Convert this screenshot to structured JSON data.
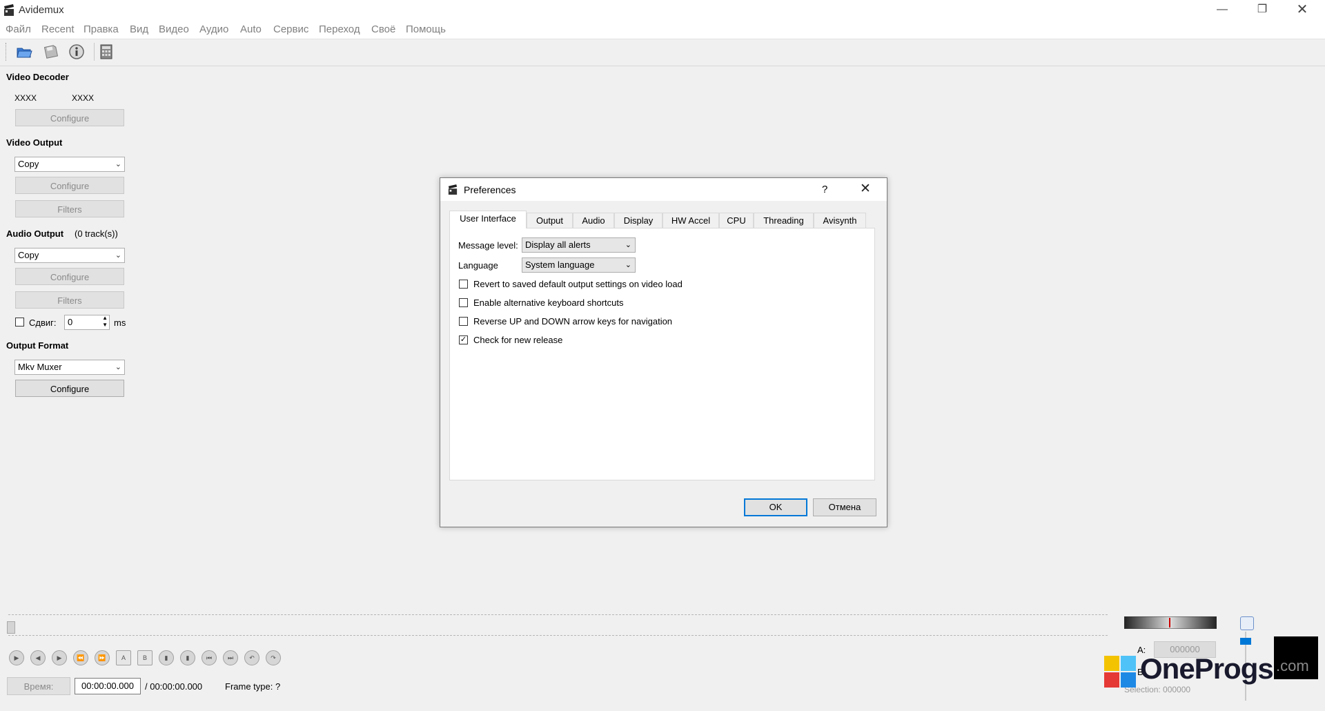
{
  "app": {
    "title": "Avidemux"
  },
  "menu": [
    "Файл",
    "Recent",
    "Правка",
    "Вид",
    "Видео",
    "Аудио",
    "Auto",
    "Сервис",
    "Переход",
    "Своё",
    "Помощь"
  ],
  "left_panel": {
    "video_decoder": {
      "heading": "Video Decoder",
      "codec_a": "XXXX",
      "codec_b": "XXXX",
      "configure": "Configure"
    },
    "video_output": {
      "heading": "Video Output",
      "codec": "Copy",
      "configure": "Configure",
      "filters": "Filters"
    },
    "audio_output": {
      "heading": "Audio Output",
      "tracks": "(0 track(s))",
      "codec": "Copy",
      "configure": "Configure",
      "filters": "Filters",
      "shift_label": "Сдвиг:",
      "shift_value": "0",
      "shift_unit": "ms"
    },
    "output_format": {
      "heading": "Output Format",
      "muxer": "Mkv Muxer",
      "configure": "Configure"
    }
  },
  "dialog": {
    "title": "Preferences",
    "help": "?",
    "tabs": [
      "User Interface",
      "Output",
      "Audio",
      "Display",
      "HW Accel",
      "CPU",
      "Threading",
      "Avisynth"
    ],
    "active_tab": "User Interface",
    "message_level_label": "Message level:",
    "message_level_value": "Display all alerts",
    "language_label": "Language",
    "language_value": "System language",
    "checkboxes": [
      {
        "label": "Revert to saved default output settings on video load",
        "checked": false
      },
      {
        "label": "Enable alternative keyboard shortcuts",
        "checked": false
      },
      {
        "label": "Reverse UP and DOWN arrow keys for navigation",
        "checked": false
      },
      {
        "label": "Check for new release",
        "checked": true
      }
    ],
    "ok": "OK",
    "cancel": "Отмена"
  },
  "bottom": {
    "time_button": "Время:",
    "current_time": "00:00:00.000",
    "total_time": "/ 00:00:00.000",
    "frame_type": "Frame type:  ?",
    "a_label": "A:",
    "a_value": "000000",
    "b_label": "B:",
    "selection": "Selection: 000000"
  },
  "watermark": {
    "text": "OneProgs",
    "suffix": ".com"
  }
}
